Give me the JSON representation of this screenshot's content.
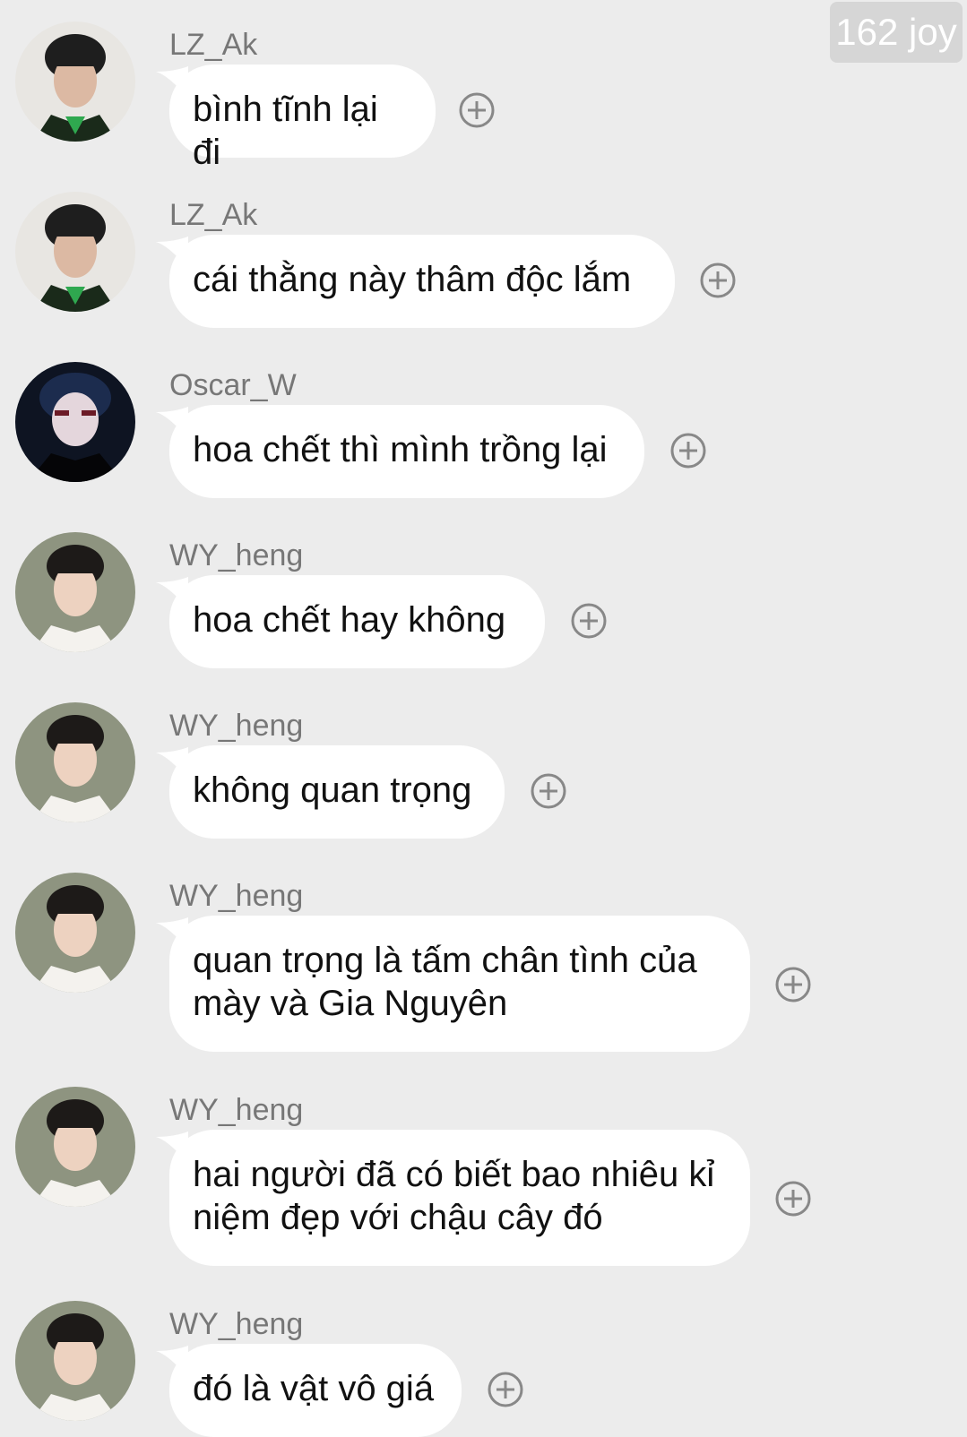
{
  "watermark": "162 joy",
  "icons": {
    "add": "plus-circle-icon",
    "avatar": "user-avatar"
  },
  "colors": {
    "background": "#ececec",
    "bubble": "#ffffff",
    "name": "#777777",
    "text": "#111111",
    "icon": "#888888"
  },
  "messages": [
    {
      "sender": "LZ_Ak",
      "text": "bình tĩnh lại đi",
      "avatar": "avatar-lz"
    },
    {
      "sender": "LZ_Ak",
      "text": "cái thằng này thâm độc lắm",
      "avatar": "avatar-lz"
    },
    {
      "sender": "Oscar_W",
      "text": "hoa chết thì mình trồng lại",
      "avatar": "avatar-oscar"
    },
    {
      "sender": "WY_heng",
      "text": "hoa chết hay không",
      "avatar": "avatar-wy"
    },
    {
      "sender": "WY_heng",
      "text": "không quan trọng",
      "avatar": "avatar-wy"
    },
    {
      "sender": "WY_heng",
      "text_lines": [
        "quan trọng là tấm chân tình của",
        "mày và Gia Nguyên"
      ],
      "avatar": "avatar-wy"
    },
    {
      "sender": "WY_heng",
      "text_lines": [
        "hai người đã có biết bao nhiêu kỉ",
        "niệm đẹp với chậu cây đó"
      ],
      "avatar": "avatar-wy"
    },
    {
      "sender": "WY_heng",
      "text": "đó là vật vô giá",
      "avatar": "avatar-wy"
    }
  ]
}
